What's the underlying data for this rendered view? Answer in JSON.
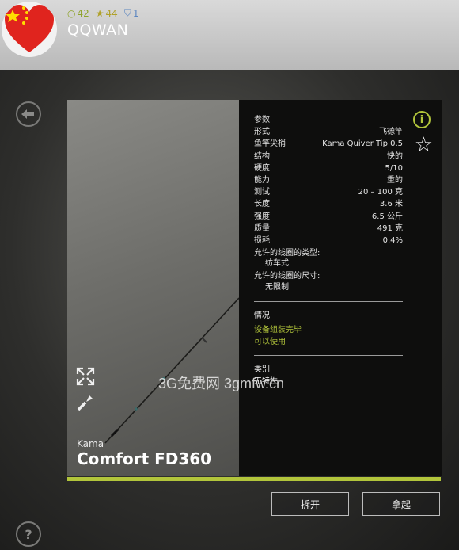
{
  "header": {
    "username": "QQWAN",
    "stats": {
      "coins": "42",
      "stars": "44",
      "shield": "1"
    },
    "colors": {
      "green": "#8ea32b",
      "yellow": "#b0a12a",
      "blue": "#5c86c0"
    }
  },
  "icons": {
    "back": "back-arrow-icon",
    "help": "question-icon",
    "expand": "expand-icon",
    "repair": "repair-icon",
    "info": "info-icon",
    "favorite": "star-icon"
  },
  "item": {
    "brand": "Kama",
    "model": "Comfort FD360"
  },
  "specs": {
    "title": "参数",
    "rows": [
      {
        "k": "形式",
        "v": "飞德竿"
      },
      {
        "k": "鱼竿尖梢",
        "v": "Kama Quiver Tip 0.5"
      },
      {
        "k": "结构",
        "v": "快的"
      },
      {
        "k": "硬度",
        "v": "5/10"
      },
      {
        "k": "能力",
        "v": "重的"
      },
      {
        "k": "测试",
        "v": "20 – 100 克"
      },
      {
        "k": "长度",
        "v": "3.6 米"
      },
      {
        "k": "强度",
        "v": "6.5 公斤"
      },
      {
        "k": "质量",
        "v": "491 克"
      },
      {
        "k": "损耗",
        "v": "0.4%"
      }
    ],
    "reel_type_label": "允许的线圈的类型:",
    "reel_type_value": "纺车式",
    "reel_size_label": "允许的线圈的尺寸:",
    "reel_size_value": "无限制"
  },
  "status": {
    "title": "情况",
    "line1": "设备组装完毕",
    "line2": "可以使用"
  },
  "category": {
    "title": "类别",
    "value": "无特性"
  },
  "buttons": {
    "disassemble": "拆开",
    "take": "拿起"
  },
  "watermark": "3G免费网 3gmfw.cn",
  "accent": "#b2c53b"
}
